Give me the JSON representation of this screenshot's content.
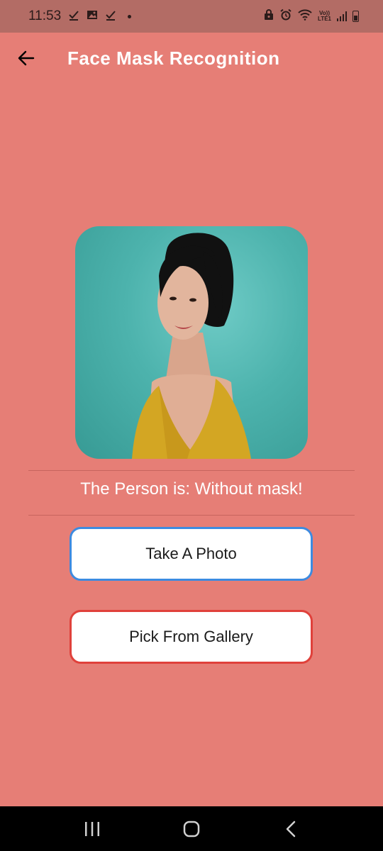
{
  "status_bar": {
    "time": "11:53",
    "left_icons": [
      "check-icon",
      "image-icon",
      "check-icon",
      "dot-icon"
    ],
    "right_icons": [
      "lock-icon",
      "alarm-icon",
      "wifi-icon",
      "volte-lte-icon",
      "signal-icon",
      "battery-icon"
    ],
    "lte_top": "Vo))",
    "lte_bottom": "LTE1"
  },
  "app_bar": {
    "title": "Face Mask Recognition",
    "back_icon": "arrow-left-icon"
  },
  "photo": {
    "alt": "Portrait of a woman with short dark hair in a mustard top against a teal background"
  },
  "result": {
    "text": "The Person is: Without mask!"
  },
  "buttons": {
    "take_photo": "Take A Photo",
    "pick_gallery": "Pick From Gallery"
  },
  "nav_bar": {
    "recents_icon": "recents-icon",
    "home_icon": "home-icon",
    "back_icon": "nav-back-icon"
  },
  "colors": {
    "background": "#e67e76",
    "status_bar": "#b36c65",
    "take_photo_border": "#3d8be0",
    "gallery_border": "#e0413b"
  }
}
